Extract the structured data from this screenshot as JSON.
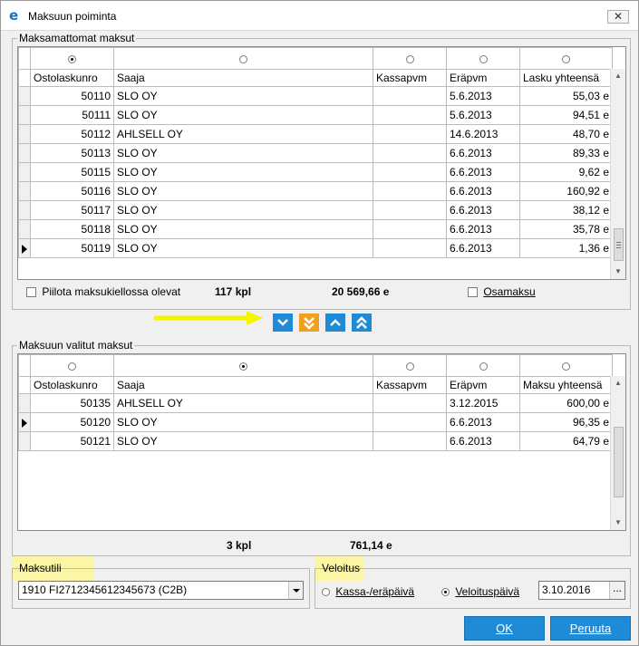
{
  "window": {
    "title": "Maksuun poiminta",
    "close_label": "✕"
  },
  "unpaid": {
    "group_label": "Maksamattomat maksut",
    "radio_selected_column": 0,
    "columns": [
      "Ostolaskunro",
      "Saaja",
      "Kassapvm",
      "Eräpvm",
      "Lasku yhteensä"
    ],
    "rows": [
      [
        "50110",
        "SLO OY",
        "",
        "5.6.2013",
        "55,03 e"
      ],
      [
        "50111",
        "SLO OY",
        "",
        "5.6.2013",
        "94,51 e"
      ],
      [
        "50112",
        "AHLSELL OY",
        "",
        "14.6.2013",
        "48,70 e"
      ],
      [
        "50113",
        "SLO OY",
        "",
        "6.6.2013",
        "89,33 e"
      ],
      [
        "50115",
        "SLO OY",
        "",
        "6.6.2013",
        "9,62 e"
      ],
      [
        "50116",
        "SLO OY",
        "",
        "6.6.2013",
        "160,92 e"
      ],
      [
        "50117",
        "SLO OY",
        "",
        "6.6.2013",
        "38,12 e"
      ],
      [
        "50118",
        "SLO OY",
        "",
        "6.6.2013",
        "35,78 e"
      ],
      [
        "50119",
        "SLO OY",
        "",
        "6.6.2013",
        "1,36 e"
      ]
    ],
    "current_row": 8,
    "hide_blocked_label": "Piilota maksukiellossa olevat",
    "hide_blocked_checked": false,
    "count": "117 kpl",
    "total": "20 569,66 e",
    "partial_payment_label": "Osamaksu",
    "partial_payment_checked": false
  },
  "move_buttons": [
    {
      "name": "move-down-one-button",
      "icon": "chevron-down-icon",
      "color": "#1f8ad6"
    },
    {
      "name": "move-down-all-button",
      "icon": "double-chevron-down-icon",
      "color": "#f0a020"
    },
    {
      "name": "move-up-one-button",
      "icon": "chevron-up-icon",
      "color": "#1f8ad6"
    },
    {
      "name": "move-up-all-button",
      "icon": "double-chevron-up-icon",
      "color": "#1f8ad6"
    }
  ],
  "selected": {
    "group_label": "Maksuun valitut maksut",
    "radio_selected_column": 1,
    "columns": [
      "Ostolaskunro",
      "Saaja",
      "Kassapvm",
      "Eräpvm",
      "Maksu yhteensä"
    ],
    "rows": [
      [
        "50135",
        "AHLSELL OY",
        "",
        "3.12.2015",
        "600,00 e"
      ],
      [
        "50120",
        "SLO OY",
        "",
        "6.6.2013",
        "96,35 e"
      ],
      [
        "50121",
        "SLO OY",
        "",
        "6.6.2013",
        "64,79 e"
      ]
    ],
    "current_row": 1,
    "count": "3 kpl",
    "total": "761,14 e"
  },
  "account": {
    "group_label": "Maksutili",
    "value": "1910 FI2712345612345673 (C2B)"
  },
  "charge": {
    "group_label": "Veloitus",
    "option_due_label": "Kassa-/eräpäivä",
    "option_charge_label": "Veloituspäivä",
    "selected_option": "charge",
    "date_value": "3.10.2016",
    "date_button_label": "..."
  },
  "buttons": {
    "ok_label": "OK",
    "cancel_label": "Peruuta"
  },
  "colors": {
    "accent": "#1f8ad6",
    "highlight": "#fbf6a5",
    "arrow": "#f5f500"
  }
}
